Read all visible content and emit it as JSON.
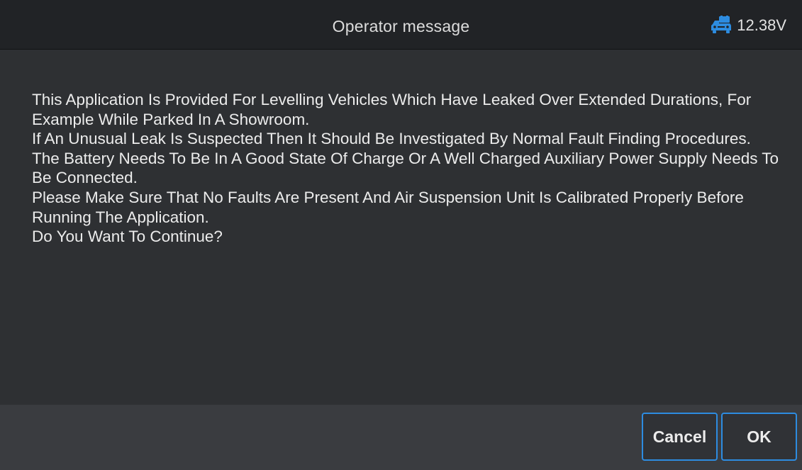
{
  "header": {
    "title": "Operator message",
    "voltage": "12.38V",
    "voltage_icon": "car-battery-icon",
    "accent_color": "#2d8ce0"
  },
  "message": {
    "lines": [
      "This Application Is Provided For Levelling Vehicles Which Have Leaked Over Extended Durations, For Example While Parked In A Showroom.",
      "If An Unusual Leak Is Suspected Then It Should Be Investigated By Normal Fault Finding Procedures.",
      "The Battery Needs To Be In A Good State Of Charge Or A Well Charged Auxiliary Power Supply Needs To Be Connected.",
      "Please Make Sure That No Faults Are Present And Air Suspension Unit Is Calibrated Properly Before Running The Application.",
      "Do You Want To Continue?"
    ]
  },
  "footer": {
    "cancel_label": "Cancel",
    "ok_label": "OK"
  }
}
